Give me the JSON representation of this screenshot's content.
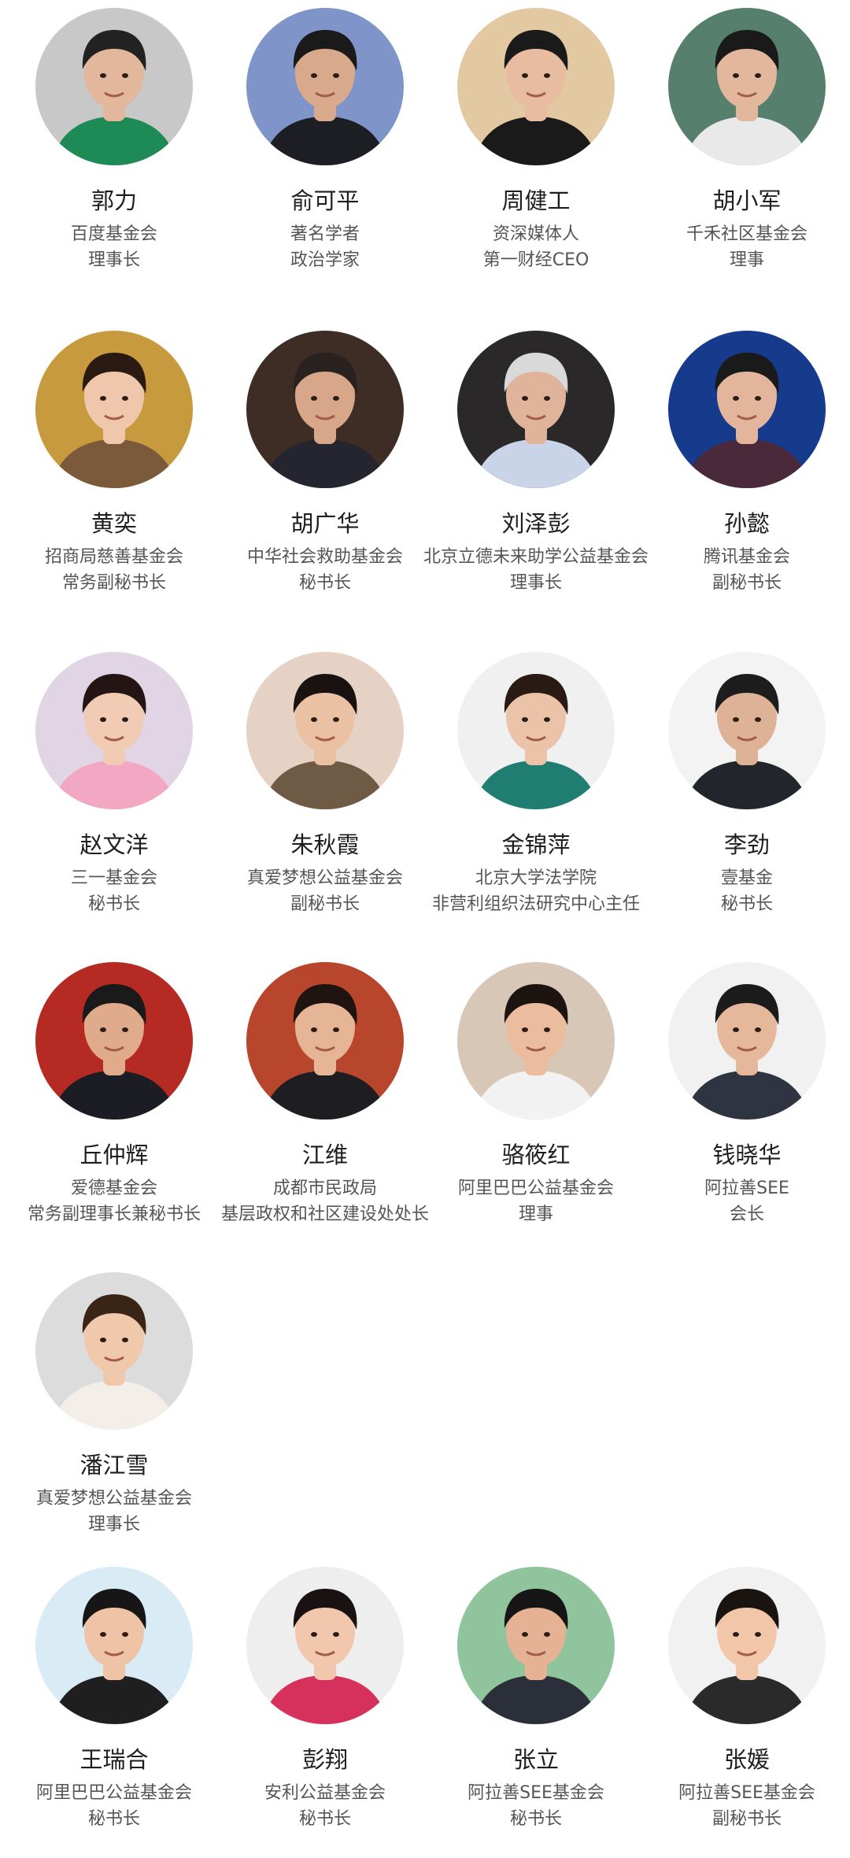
{
  "people": [
    {
      "name": "郭力",
      "org": "百度基金会",
      "role": "理事长",
      "bg": "#c8c8c8",
      "shirt": "#1e8a56",
      "hair": "#222222",
      "skin": "#e3b79c"
    },
    {
      "name": "俞可平",
      "org": "著名学者",
      "role": "政治学家",
      "bg": "#7f95c9",
      "shirt": "#1d1d24",
      "hair": "#1a1a1a",
      "skin": "#d9a98c"
    },
    {
      "name": "周健工",
      "org": "资深媒体人",
      "role": "第一财经CEO",
      "bg": "#e3c9a2",
      "shirt": "#1a1a1a",
      "hair": "#1a1a1a",
      "skin": "#e7bca0"
    },
    {
      "name": "胡小军",
      "org": "千禾社区基金会",
      "role": "理事",
      "bg": "#567f6e",
      "shirt": "#e9e9e9",
      "hair": "#1a1a1a",
      "skin": "#e2b79b"
    },
    {
      "name": "黄奕",
      "org": "招商局慈善基金会",
      "role": "常务副秘书长",
      "bg": "#c79a3d",
      "shirt": "#7a5a3a",
      "hair": "#2a1a12",
      "skin": "#efc7ac"
    },
    {
      "name": "胡广华",
      "org": "中华社会救助基金会",
      "role": "秘书长",
      "bg": "#3e2d24",
      "shirt": "#252530",
      "hair": "#2a2220",
      "skin": "#d8a689"
    },
    {
      "name": "刘泽彭",
      "org": "北京立德未来助学公益基金会",
      "role": "理事长",
      "bg": "#2a2828",
      "shirt": "#c9d4e8",
      "hair": "#d9d9d9",
      "skin": "#e0b49a"
    },
    {
      "name": "孙懿",
      "org": "腾讯基金会",
      "role": "副秘书长",
      "bg": "#163a8c",
      "shirt": "#4a2a3a",
      "hair": "#1a1a1a",
      "skin": "#e2b59c"
    },
    {
      "name": "赵文洋",
      "org": "三一基金会",
      "role": "秘书长",
      "bg": "#e1d4e4",
      "shirt": "#f2a7c2",
      "hair": "#241414",
      "skin": "#f1cbb4"
    },
    {
      "name": "朱秋霞",
      "org": "真爱梦想公益基金会",
      "role": "副秘书长",
      "bg": "#e6d2c4",
      "shirt": "#6f5a45",
      "hair": "#1a1210",
      "skin": "#ebc1a4"
    },
    {
      "name": "金锦萍",
      "org": "北京大学法学院",
      "role": "非营利组织法研究中心主任",
      "bg": "#f0f0f0",
      "shirt": "#1f7d72",
      "hair": "#2a1a14",
      "skin": "#eac3a8"
    },
    {
      "name": "李劲",
      "org": "壹基金",
      "role": "秘书长",
      "bg": "#f3f3f3",
      "shirt": "#22262c",
      "hair": "#1d1d1d",
      "skin": "#ddb296"
    },
    {
      "name": "丘仲辉",
      "org": "爱德基金会",
      "role": "常务副理事长兼秘书长",
      "bg": "#b52a23",
      "shirt": "#1c1c24",
      "hair": "#1a1a1a",
      "skin": "#e0ab8b"
    },
    {
      "name": "江维",
      "org": "成都市民政局",
      "role": "基层政权和社区建设处处长",
      "bg": "#b8462c",
      "shirt": "#1e1e22",
      "hair": "#1f1410",
      "skin": "#e5b596"
    },
    {
      "name": "骆筱红",
      "org": "阿里巴巴公益基金会",
      "role": "理事",
      "bg": "#d8c7b7",
      "shirt": "#f2f2f2",
      "hair": "#1c1410",
      "skin": "#ebbd9e"
    },
    {
      "name": "钱晓华",
      "org": "阿拉善SEE",
      "role": "会长",
      "bg": "#f1f1f1",
      "shirt": "#2e3440",
      "hair": "#1b1b1b",
      "skin": "#e5b89b"
    },
    {
      "name": "潘江雪",
      "org": "真爱梦想公益基金会",
      "role": "理事长",
      "bg": "#dcdcdc",
      "shirt": "#f3eee8",
      "hair": "#3a2416",
      "skin": "#f0c9ad"
    },
    {
      "name": "王瑞合",
      "org": "阿里巴巴公益基金会",
      "role": "秘书长",
      "bg": "#d9ecf6",
      "shirt": "#1f1f1f",
      "hair": "#161616",
      "skin": "#efc3a5"
    },
    {
      "name": "彭翔",
      "org": "安利公益基金会",
      "role": "秘书长",
      "bg": "#eeeeee",
      "shirt": "#d6305c",
      "hair": "#1a1212",
      "skin": "#f1c8ad"
    },
    {
      "name": "张立",
      "org": "阿拉善SEE基金会",
      "role": "秘书长",
      "bg": "#8fc49c",
      "shirt": "#2b2f3a",
      "hair": "#161616",
      "skin": "#e5b394"
    },
    {
      "name": "张媛",
      "org": "阿拉善SEE基金会",
      "role": "副秘书长",
      "bg": "#f1f1f1",
      "shirt": "#2a2a2a",
      "hair": "#1a1410",
      "skin": "#f1c6a9"
    }
  ]
}
